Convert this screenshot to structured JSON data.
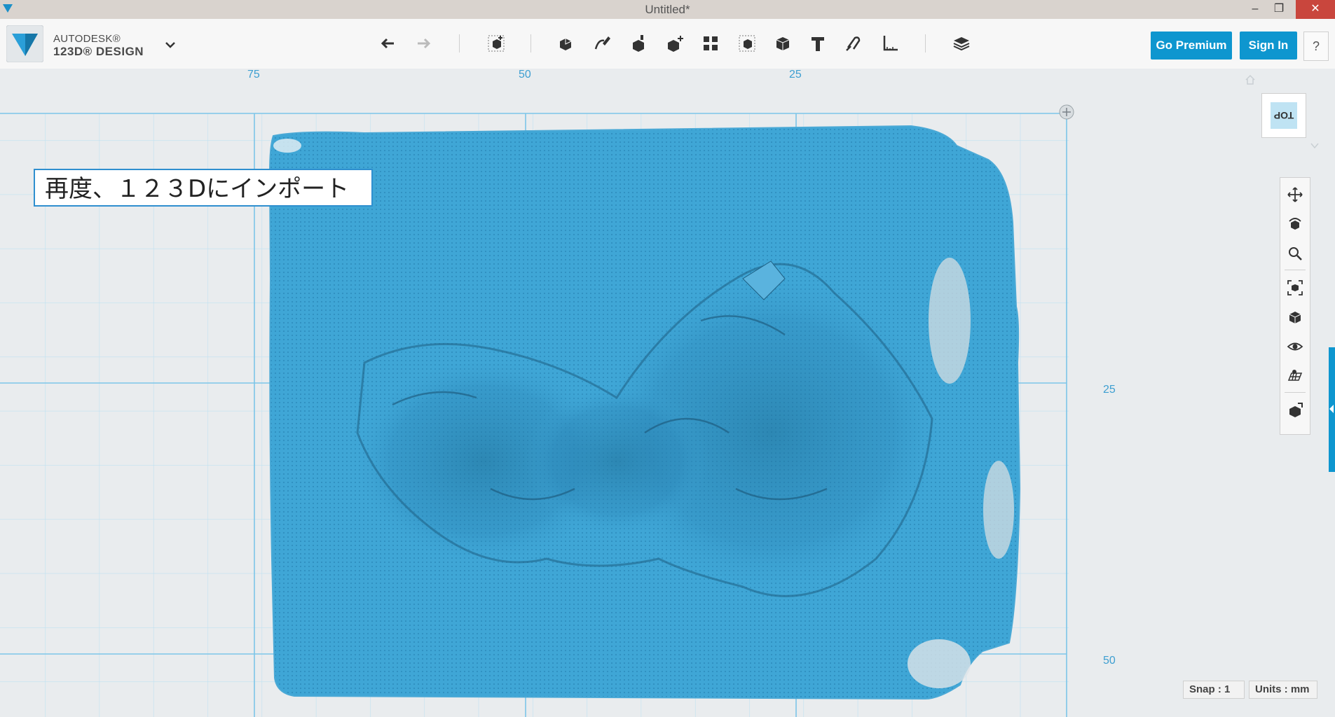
{
  "window": {
    "title": "Untitled*",
    "controls": [
      "–",
      "❐",
      "✕"
    ]
  },
  "app": {
    "brand_line1": "AUTODESK®",
    "brand_line2": "123D® DESIGN"
  },
  "toolbar": {
    "icons": [
      "undo-icon",
      "redo-icon",
      "primitives-icon",
      "sketch-icon",
      "construct-icon",
      "modify-icon",
      "pattern-icon",
      "group-icon",
      "combine-icon",
      "measure-icon",
      "text-icon",
      "snap-icon",
      "material-icon"
    ],
    "go_premium": "Go Premium",
    "sign_in": "Sign In",
    "help": "?"
  },
  "rulers": {
    "top": [
      "75",
      "50",
      "25"
    ],
    "right": [
      "25",
      "50"
    ]
  },
  "view_cube": {
    "face": "TOP"
  },
  "annotation": "再度、１２３Dにインポート",
  "status": {
    "snap": "Snap : 1",
    "units": "Units : mm"
  },
  "colors": {
    "accent": "#0e96cf",
    "mesh": "#3fa6d6",
    "grid": "#bfe1f1"
  }
}
